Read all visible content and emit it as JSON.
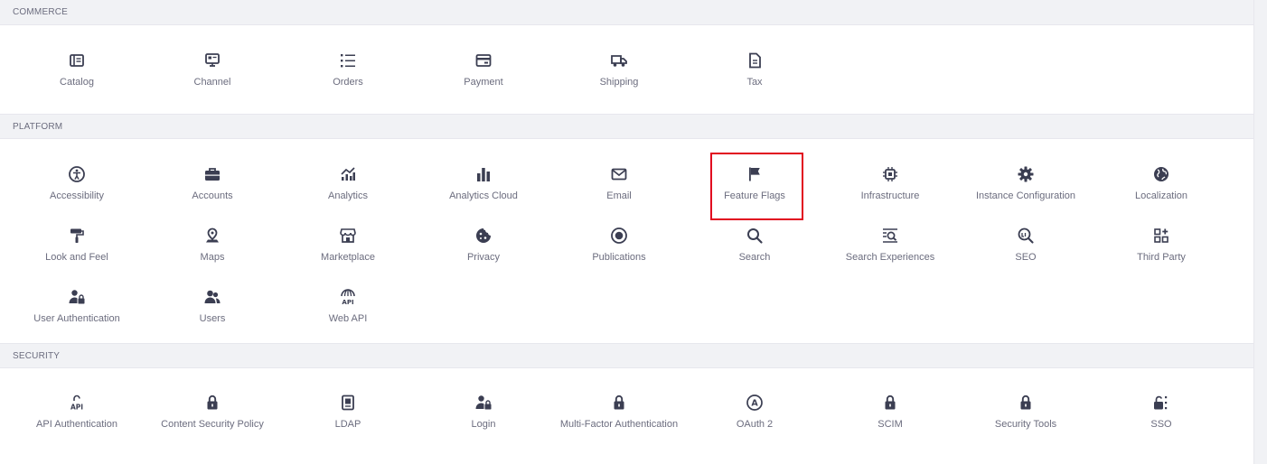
{
  "sections": [
    {
      "title": "COMMERCE",
      "items": [
        {
          "label": "Catalog",
          "icon": "catalog-icon"
        },
        {
          "label": "Channel",
          "icon": "channel-icon"
        },
        {
          "label": "Orders",
          "icon": "orders-icon"
        },
        {
          "label": "Payment",
          "icon": "payment-icon"
        },
        {
          "label": "Shipping",
          "icon": "shipping-icon"
        },
        {
          "label": "Tax",
          "icon": "tax-icon"
        }
      ]
    },
    {
      "title": "PLATFORM",
      "items": [
        {
          "label": "Accessibility",
          "icon": "accessibility-icon"
        },
        {
          "label": "Accounts",
          "icon": "accounts-icon"
        },
        {
          "label": "Analytics",
          "icon": "analytics-icon"
        },
        {
          "label": "Analytics Cloud",
          "icon": "analytics-cloud-icon"
        },
        {
          "label": "Email",
          "icon": "email-icon"
        },
        {
          "label": "Feature Flags",
          "icon": "flag-icon"
        },
        {
          "label": "Infrastructure",
          "icon": "infrastructure-icon"
        },
        {
          "label": "Instance Configuration",
          "icon": "gear-icon"
        },
        {
          "label": "Localization",
          "icon": "globe-icon"
        },
        {
          "label": "Look and Feel",
          "icon": "paint-roller-icon"
        },
        {
          "label": "Maps",
          "icon": "map-pin-icon"
        },
        {
          "label": "Marketplace",
          "icon": "storefront-icon"
        },
        {
          "label": "Privacy",
          "icon": "cookie-icon"
        },
        {
          "label": "Publications",
          "icon": "publications-icon"
        },
        {
          "label": "Search",
          "icon": "search-icon"
        },
        {
          "label": "Search Experiences",
          "icon": "search-experiences-icon"
        },
        {
          "label": "SEO",
          "icon": "seo-icon"
        },
        {
          "label": "Third Party",
          "icon": "third-party-icon"
        },
        {
          "label": "User Authentication",
          "icon": "user-lock-icon"
        },
        {
          "label": "Users",
          "icon": "users-icon"
        },
        {
          "label": "Web API",
          "icon": "web-api-icon"
        }
      ]
    },
    {
      "title": "SECURITY",
      "items": [
        {
          "label": "API Authentication",
          "icon": "api-lock-icon"
        },
        {
          "label": "Content Security Policy",
          "icon": "lock-icon"
        },
        {
          "label": "LDAP",
          "icon": "ldap-icon"
        },
        {
          "label": "Login",
          "icon": "user-lock-icon"
        },
        {
          "label": "Multi-Factor Authentication",
          "icon": "lock-icon"
        },
        {
          "label": "OAuth 2",
          "icon": "oauth-icon"
        },
        {
          "label": "SCIM",
          "icon": "lock-icon"
        },
        {
          "label": "Security Tools",
          "icon": "lock-icon"
        },
        {
          "label": "SSO",
          "icon": "sso-icon"
        }
      ]
    }
  ],
  "highlighted_item": "Feature Flags",
  "colors": {
    "icon": "#3b3e52",
    "label": "#6b6c7e",
    "header_bg": "#f1f2f5",
    "highlight": "#e1051f"
  }
}
